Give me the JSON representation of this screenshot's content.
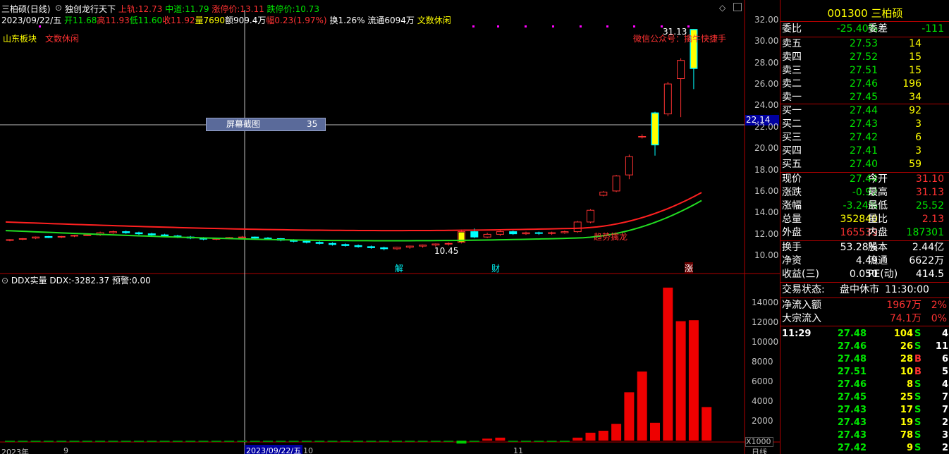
{
  "header": {
    "stock_name": "三柏硕",
    "period": "(日线)",
    "indicator_name": "独创龙行天下",
    "upper_rail_label": "上轨:",
    "upper_rail_value": "12.73",
    "mid_rail_label": "中道:",
    "mid_rail_value": "11.79",
    "limit_up_label": "涨停价:",
    "limit_up_value": "13.11",
    "limit_down_label": "跌停价:",
    "limit_down_value": "10.73"
  },
  "ohlc_line": {
    "date": "2023/09/22/五",
    "open": "开11.68",
    "high": "高11.93",
    "low": "低11.60",
    "close": "收11.92",
    "volume": "量7690",
    "amount": "额909.4万",
    "change": "幅0.23(1.97%)",
    "turnover": "换1.26%",
    "float": "流通6094万",
    "tag": "文数休闲"
  },
  "chart_labels": {
    "sector": "山东板块",
    "sector_tag": "文数休闲",
    "watermark": "微信公众号：擒牛快捷手",
    "high_marker": "31.13",
    "low_marker": "10.45",
    "crosshair_price": "22.14",
    "tooltip_label": "屏幕截图",
    "tooltip_value": "35",
    "signal_text": "趋势擒龙",
    "event_jie": "解",
    "event_cai": "财",
    "event_zhang": "涨"
  },
  "price_axis": [
    "32.00",
    "30.00",
    "28.00",
    "26.00",
    "24.00",
    "22.00",
    "20.00",
    "18.00",
    "16.00",
    "14.00",
    "12.00",
    "10.00"
  ],
  "sub_panel": {
    "title": "DDX实量",
    "ddx_label": "DDX:",
    "ddx_value": "-3282.37",
    "warn_label": "预警:",
    "warn_value": "0.00",
    "unit": "X1000",
    "axis": [
      "14000",
      "12000",
      "10000",
      "8000",
      "6000",
      "4000",
      "2000"
    ]
  },
  "time_axis": {
    "year": "2023年",
    "m9": "9",
    "crosshair_date": "2023/09/22/五",
    "m10": "10",
    "m11": "11",
    "period_btn": "日线"
  },
  "chart_data": {
    "type": "candlestick",
    "title": "三柏硕 (日线)",
    "ylim": [
      9.0,
      32.5
    ],
    "candles": [
      [
        11.4,
        11.5,
        11.3,
        11.45
      ],
      [
        11.5,
        11.6,
        11.4,
        11.55
      ],
      [
        11.6,
        11.75,
        11.5,
        11.7
      ],
      [
        11.75,
        11.8,
        11.6,
        11.65
      ],
      [
        11.7,
        11.8,
        11.6,
        11.75
      ],
      [
        11.8,
        11.9,
        11.7,
        11.85
      ],
      [
        11.9,
        12.0,
        11.8,
        11.9
      ],
      [
        11.9,
        12.2,
        11.8,
        12.1
      ],
      [
        12.1,
        12.3,
        12.0,
        12.2
      ],
      [
        12.2,
        12.3,
        12.0,
        12.1
      ],
      [
        12.1,
        12.2,
        11.9,
        12.0
      ],
      [
        12.0,
        12.1,
        11.8,
        11.9
      ],
      [
        11.9,
        12.0,
        11.7,
        11.8
      ],
      [
        11.8,
        11.9,
        11.6,
        11.75
      ],
      [
        11.7,
        11.8,
        11.5,
        11.6
      ],
      [
        11.6,
        11.7,
        11.4,
        11.5
      ],
      [
        11.5,
        11.6,
        11.4,
        11.55
      ],
      [
        11.55,
        11.7,
        11.5,
        11.65
      ],
      [
        11.65,
        11.8,
        11.6,
        11.7
      ],
      [
        11.7,
        11.75,
        11.5,
        11.6
      ],
      [
        11.6,
        11.7,
        11.5,
        11.55
      ],
      [
        11.55,
        11.6,
        11.3,
        11.4
      ],
      [
        11.4,
        11.5,
        11.2,
        11.3
      ],
      [
        11.3,
        11.4,
        11.1,
        11.2
      ],
      [
        11.2,
        11.3,
        11.0,
        11.1
      ],
      [
        11.1,
        11.2,
        10.9,
        11.0
      ],
      [
        11.0,
        11.1,
        10.8,
        10.9
      ],
      [
        10.9,
        11.0,
        10.7,
        10.8
      ],
      [
        10.8,
        10.9,
        10.6,
        10.7
      ],
      [
        10.7,
        10.8,
        10.45,
        10.6
      ],
      [
        10.6,
        10.8,
        10.5,
        10.75
      ],
      [
        10.75,
        10.9,
        10.6,
        10.85
      ],
      [
        10.85,
        11.0,
        10.7,
        10.95
      ],
      [
        10.95,
        11.1,
        10.8,
        11.05
      ],
      [
        11.05,
        11.2,
        10.9,
        11.1
      ],
      [
        11.2,
        12.4,
        11.1,
        12.2
      ],
      [
        12.2,
        12.5,
        11.6,
        11.7
      ],
      [
        11.7,
        12.1,
        11.6,
        11.95
      ],
      [
        11.95,
        12.3,
        11.8,
        12.2
      ],
      [
        12.2,
        12.3,
        11.9,
        12.0
      ],
      [
        12.0,
        12.2,
        11.9,
        12.1
      ],
      [
        12.1,
        12.2,
        11.9,
        12.05
      ],
      [
        12.05,
        12.2,
        11.9,
        12.1
      ],
      [
        12.1,
        12.3,
        12.0,
        12.2
      ],
      [
        12.2,
        13.2,
        12.1,
        13.1
      ],
      [
        13.1,
        14.3,
        13.0,
        14.2
      ],
      [
        15.6,
        16.0,
        15.5,
        15.9
      ],
      [
        16.0,
        17.5,
        15.9,
        17.4
      ],
      [
        17.5,
        19.4,
        17.1,
        19.2
      ],
      [
        21.1,
        21.3,
        20.9,
        21.1
      ],
      [
        23.3,
        23.4,
        19.3,
        20.3
      ],
      [
        23.2,
        26.2,
        23.0,
        26.0
      ],
      [
        26.5,
        28.4,
        22.9,
        28.2
      ],
      [
        31.1,
        31.13,
        25.52,
        27.44
      ]
    ],
    "ddx": [
      0,
      0,
      0,
      0,
      0,
      0,
      0,
      0,
      0,
      0,
      0,
      0,
      0,
      0,
      0,
      0,
      0,
      0,
      0,
      0,
      0,
      0,
      0,
      0,
      0,
      0,
      0,
      0,
      0,
      0,
      0,
      0,
      0,
      0,
      0,
      -300,
      0,
      200,
      300,
      0,
      0,
      0,
      0,
      0,
      300,
      800,
      1000,
      1700,
      4900,
      7000,
      1800,
      15500,
      12100,
      12200,
      3400
    ]
  }
}
